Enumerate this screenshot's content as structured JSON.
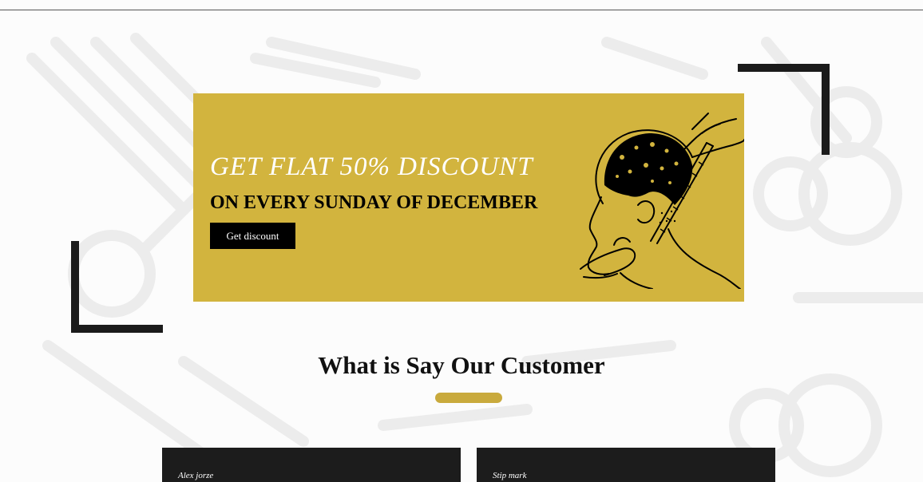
{
  "promo": {
    "heading": "GET FLAT 50% DISCOUNT",
    "subheading": "ON EVERY SUNDAY OF DECEMBER",
    "button_label": "Get discount"
  },
  "testimonials": {
    "title": "What is Say Our Customer",
    "cards": [
      {
        "name": "Alex jorze"
      },
      {
        "name": "Stip mark"
      }
    ]
  },
  "colors": {
    "accent_gold": "#d2b43e",
    "dark": "#1c1c1c",
    "light_text": "#ffffff"
  },
  "icons": {
    "background_pattern": [
      "comb-icon",
      "scissors-icon",
      "flower-icon",
      "razor-icon"
    ],
    "promo_illustration": "barber-cutting-hair-illustration"
  }
}
